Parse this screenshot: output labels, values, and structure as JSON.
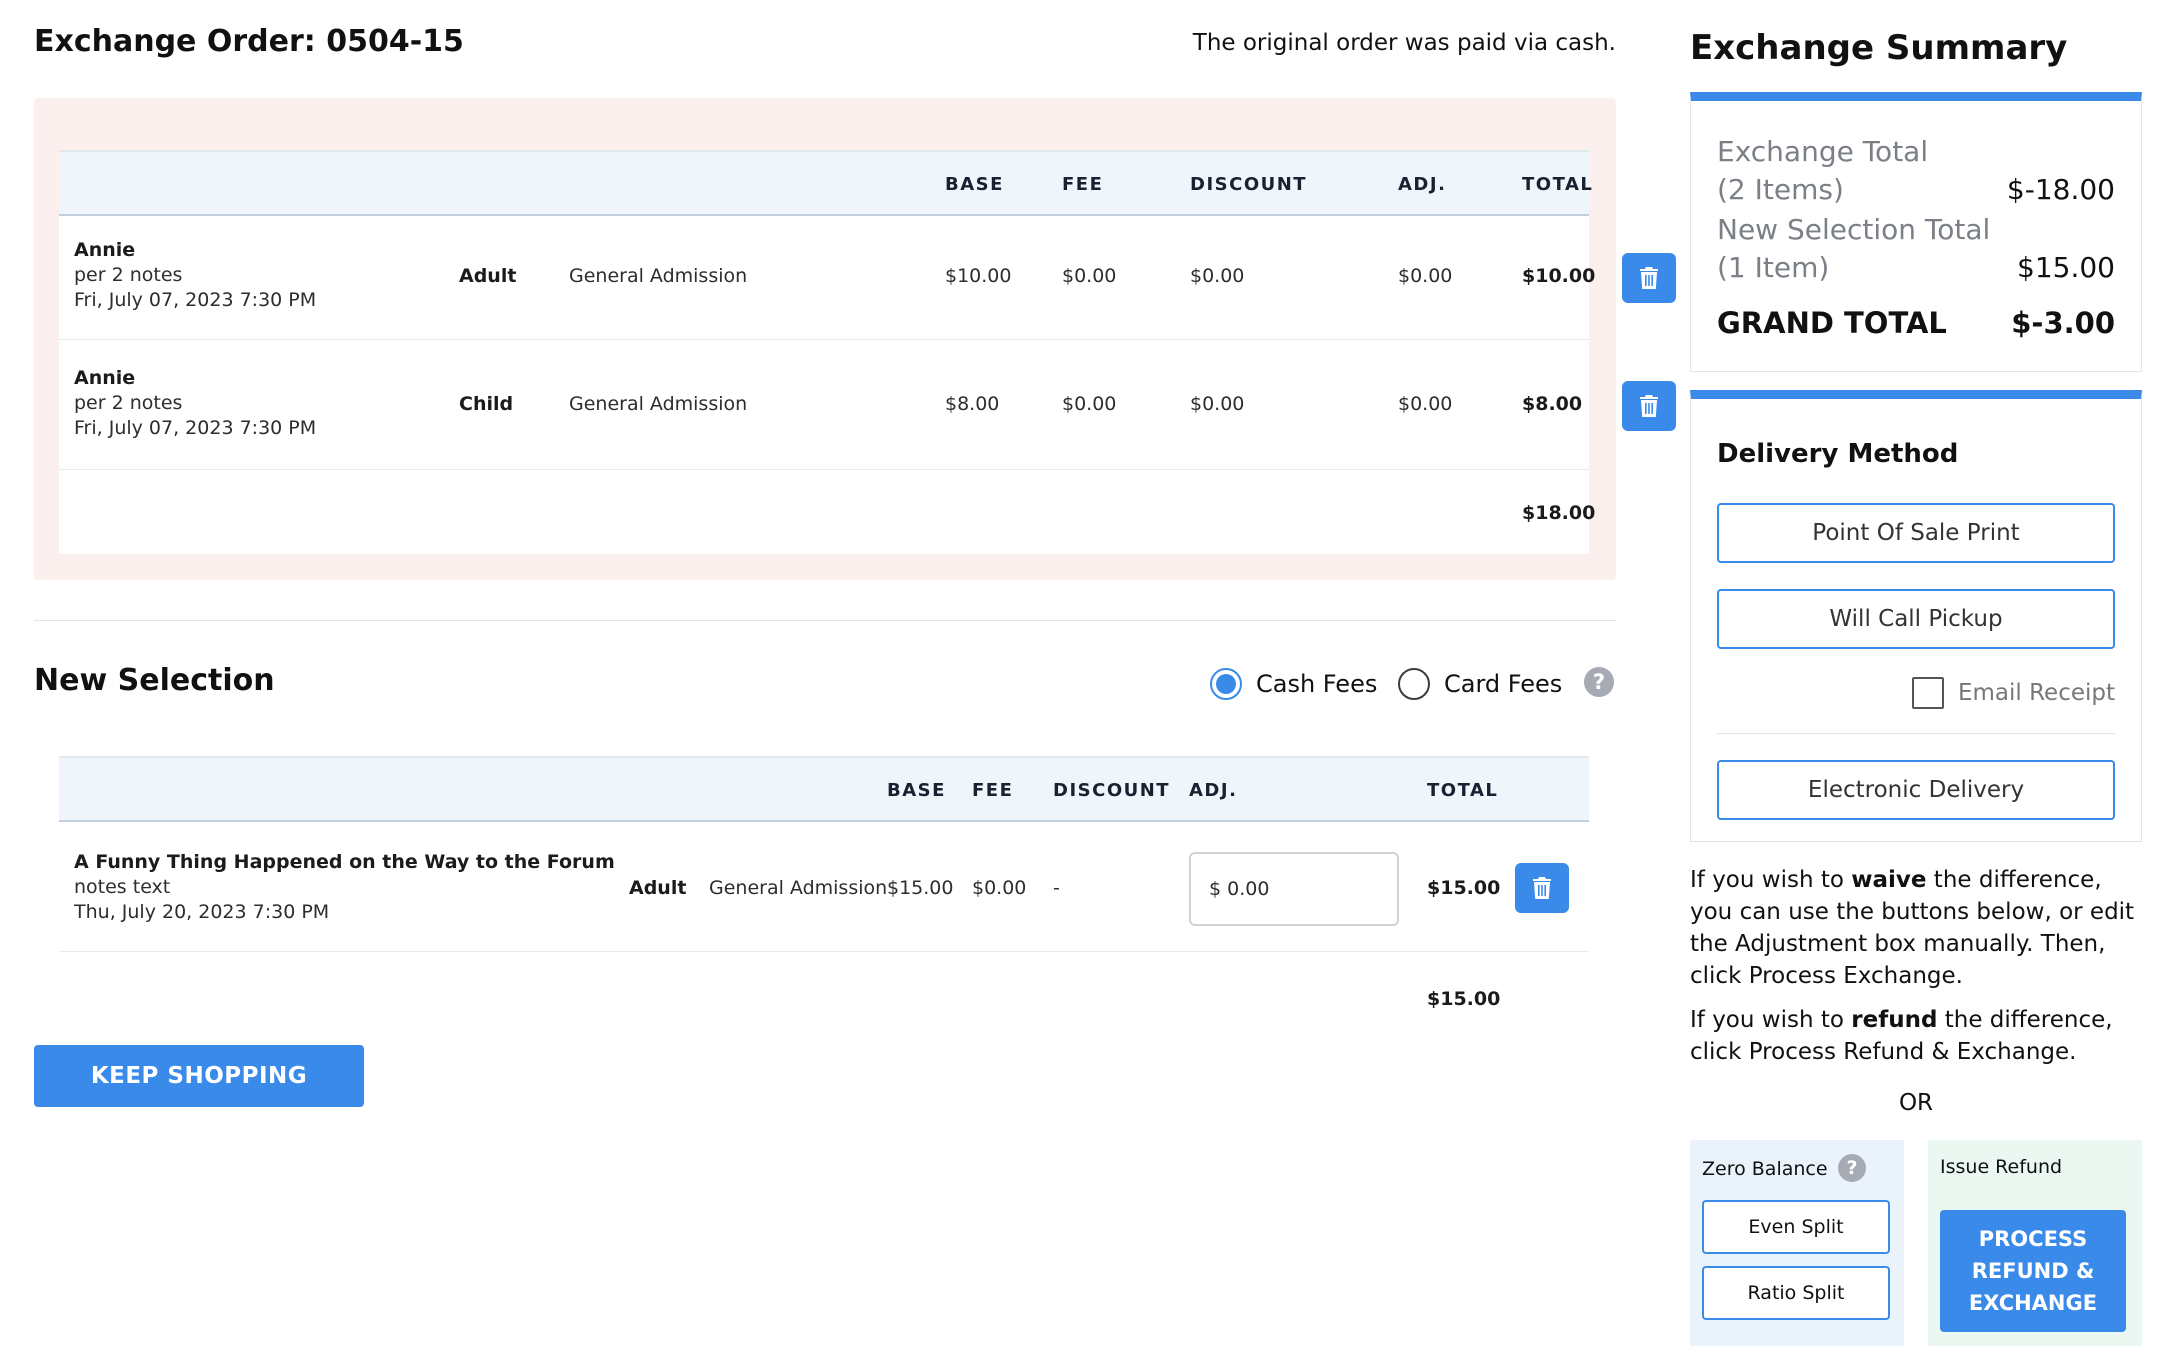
{
  "header": {
    "order_title": "Exchange Order: 0504-15",
    "paid_note": "The original order was paid via cash."
  },
  "exchange_table": {
    "columns": [
      "BASE",
      "FEE",
      "DISCOUNT",
      "ADJ.",
      "TOTAL"
    ],
    "rows": [
      {
        "name": "Annie",
        "notes": "per 2 notes",
        "datetime": "Fri, July 07, 2023 7:30 PM",
        "type": "Adult",
        "section": "General Admission",
        "base": "$10.00",
        "fee": "$0.00",
        "discount": "$0.00",
        "adj": "$0.00",
        "total": "$10.00",
        "icon": "trash-icon"
      },
      {
        "name": "Annie",
        "notes": "per 2 notes",
        "datetime": "Fri, July 07, 2023 7:30 PM",
        "type": "Child",
        "section": "General Admission",
        "base": "$8.00",
        "fee": "$0.00",
        "discount": "$0.00",
        "adj": "$0.00",
        "total": "$8.00",
        "icon": "trash-icon"
      }
    ],
    "subtotal": "$18.00"
  },
  "new_selection": {
    "title": "New Selection",
    "fee_options": [
      {
        "label": "Cash Fees",
        "selected": true
      },
      {
        "label": "Card Fees",
        "selected": false
      }
    ],
    "help_icon": "question-icon",
    "columns": [
      "BASE",
      "FEE",
      "DISCOUNT",
      "ADJ.",
      "TOTAL"
    ],
    "rows": [
      {
        "name": "A Funny Thing Happened on the Way to the Forum",
        "notes": "notes text",
        "datetime": "Thu, July 20, 2023 7:30 PM",
        "type": "Adult",
        "section": "General Admission",
        "base": "$15.00",
        "fee": "$0.00",
        "discount": "-",
        "adj_value": "$ 0.00",
        "total": "$15.00",
        "icon": "trash-icon"
      }
    ],
    "subtotal": "$15.00",
    "keep_shopping": "KEEP SHOPPING"
  },
  "summary": {
    "title": "Exchange Summary",
    "exchange_total_label_1": "Exchange Total",
    "exchange_total_label_2": "(2 Items)",
    "exchange_total_value": "$-18.00",
    "new_selection_label_1": "New Selection Total",
    "new_selection_label_2": "(1 Item)",
    "new_selection_value": "$15.00",
    "grand_total_label": "GRAND TOTAL",
    "grand_total_value": "$-3.00"
  },
  "delivery": {
    "title": "Delivery Method",
    "options": [
      "Point Of Sale Print",
      "Will Call Pickup"
    ],
    "email_receipt": "Email Receipt",
    "electronic": "Electronic Delivery"
  },
  "instructions": {
    "waive_pre": "If you wish to ",
    "waive_bold": "waive",
    "waive_post": " the difference, you can use the buttons below, or edit the Adjustment box manually. Then, click Process Exchange.",
    "refund_pre": "If you wish to ",
    "refund_bold": "refund",
    "refund_post": " the difference, click Process Refund & Exchange.",
    "or": "OR"
  },
  "zero_balance": {
    "label": "Zero Balance",
    "even_split": "Even Split",
    "ratio_split": "Ratio Split"
  },
  "issue_refund": {
    "label": "Issue Refund",
    "button": "PROCESS REFUND & EXCHANGE"
  },
  "colors": {
    "accent": "#3a8ae9",
    "exchange_bg": "#fcf0ef",
    "table_header_bg": "#eff5fa",
    "zero_bg": "#eaf3fc",
    "refund_bg": "#eaf8f1"
  }
}
